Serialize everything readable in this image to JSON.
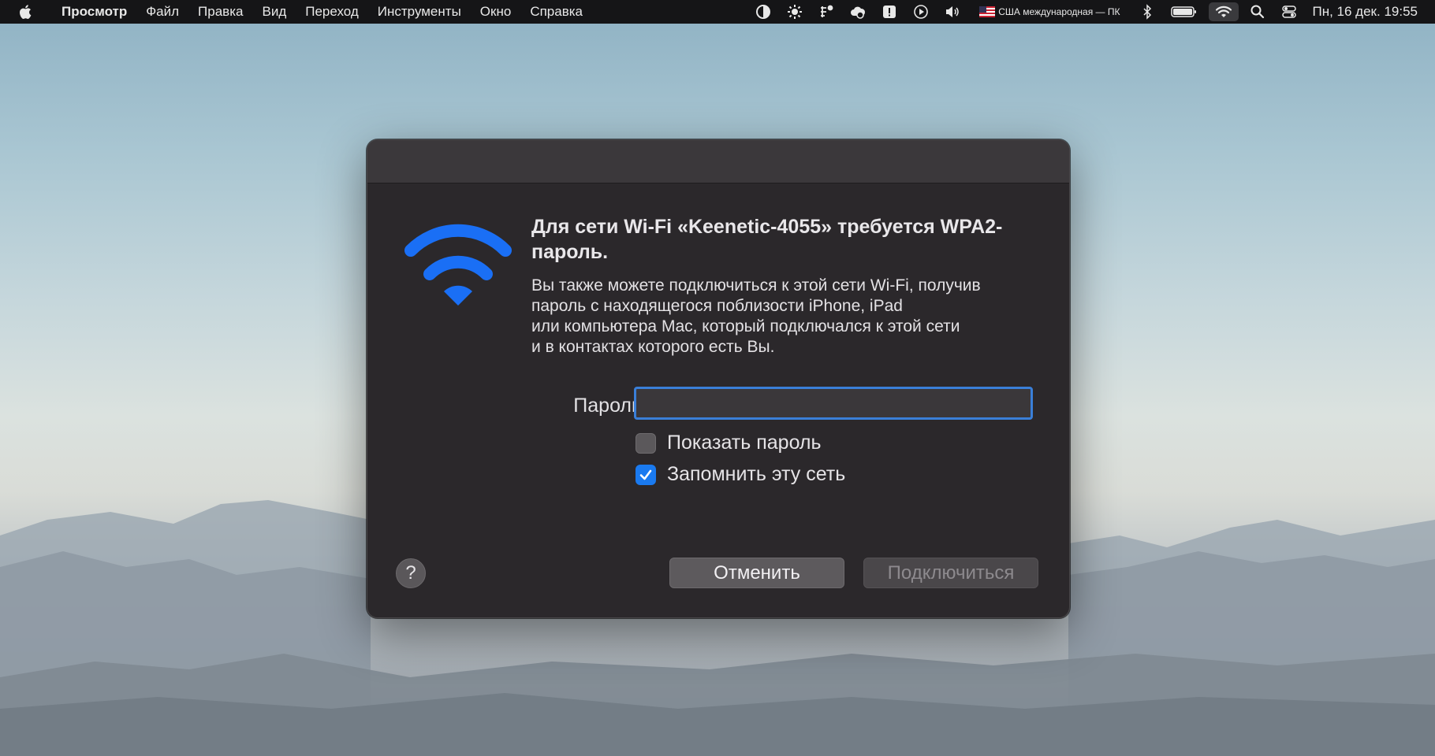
{
  "menubar": {
    "apple_icon": "apple-logo-icon",
    "app_name": "Просмотр",
    "menus": [
      "Файл",
      "Правка",
      "Вид",
      "Переход",
      "Инструменты",
      "Окно",
      "Справка"
    ],
    "status_icons": [
      "half-circle-icon",
      "sun-icon",
      "grid-shortcut-icon",
      "cloud-sync-icon",
      "exclamation-icon",
      "play-icon",
      "volume-icon"
    ],
    "keyboard_layout": "США международная — ПК",
    "clock": "Пн, 16 дек. 19:55"
  },
  "dialog": {
    "headline": "Для сети Wi-Fi «Keenetic-4055» требуется WPA2-пароль.",
    "description": [
      "Вы также можете подключиться к этой сети Wi-Fi, получив",
      "пароль с находящегося поблизости iPhone, iPad",
      "или компьютера Mac, который подключался к этой сети",
      "и в контактах которого есть Вы."
    ],
    "password_label": "Пароль:",
    "password_value": "",
    "show_password_label": "Показать пароль",
    "show_password_checked": false,
    "remember_network_label": "Запомнить эту сеть",
    "remember_network_checked": true,
    "help_label": "?",
    "cancel_label": "Отменить",
    "connect_label": "Подключиться"
  },
  "colors": {
    "accent_blue": "#1a7af0",
    "wifi_icon_blue": "#1a6ff5",
    "dialog_bg": "#2b282b"
  }
}
